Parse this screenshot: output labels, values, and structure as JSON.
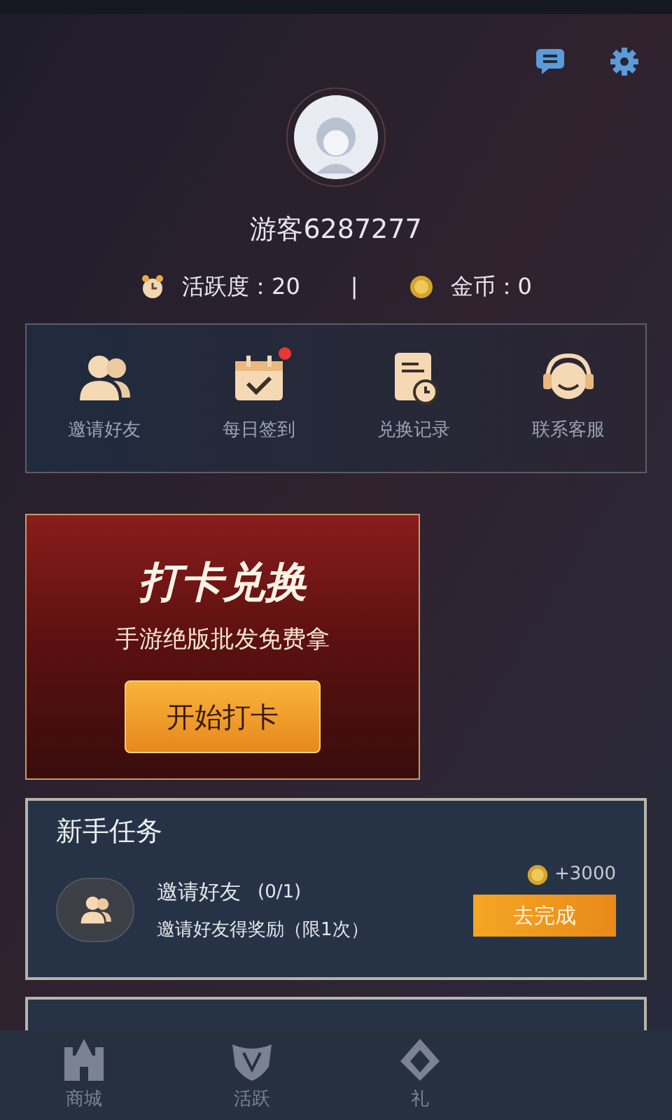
{
  "profile": {
    "name": "游客6287277",
    "activity": "活跃度：20",
    "separator": "|",
    "coins": "金币：0"
  },
  "quick_actions": [
    {
      "kind": "friends",
      "label": "邀请好友",
      "badge": false
    },
    {
      "kind": "calendar",
      "label": "每日签到",
      "badge": true
    },
    {
      "kind": "record",
      "label": "兑换记录",
      "badge": false
    },
    {
      "kind": "service",
      "label": "联系客服",
      "badge": false
    }
  ],
  "banner": {
    "title": "打卡兑换",
    "subtitle": "手游绝版批发免费拿",
    "button": "开始打卡"
  },
  "newbie_tasks": {
    "title": "新手任务",
    "tasks": [
      {
        "name": "邀请好友",
        "progress": "(0/1)",
        "description": "邀请好友得奖励（限1次）",
        "reward": "+3000",
        "button": "去完成"
      }
    ]
  },
  "bottom_nav": [
    {
      "kind": "castle",
      "label": "商城",
      "selected": false
    },
    {
      "kind": "shield",
      "label": "活跃",
      "selected": false
    },
    {
      "kind": "gift",
      "label": "礼",
      "selected": false
    }
  ]
}
